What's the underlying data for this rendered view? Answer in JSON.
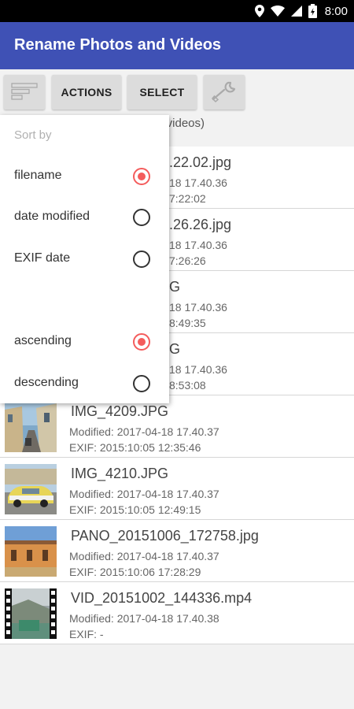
{
  "status_bar": {
    "time": "8:00",
    "icons": [
      "location-icon",
      "wifi-icon",
      "signal-icon",
      "battery-icon"
    ]
  },
  "app_bar": {
    "title": "Rename Photos and Videos",
    "color": "#3f51b5"
  },
  "toolbar": {
    "sort_icon": "sort-icon",
    "actions_label": "ACTIONS",
    "select_label": "SELECT",
    "tools_icon": "wrench-icon",
    "info_text": "s/videos)"
  },
  "sort_menu": {
    "header": "Sort by",
    "accent": "#f45c5c",
    "options": [
      {
        "label": "filename",
        "checked": true
      },
      {
        "label": "date modified",
        "checked": false
      },
      {
        "label": "EXIF date",
        "checked": false
      }
    ],
    "order": [
      {
        "label": "ascending",
        "checked": true
      },
      {
        "label": "descending",
        "checked": false
      }
    ]
  },
  "files": [
    {
      "name": ".22.02.jpg",
      "modified": "18 17.40.36",
      "exif": "7:22:02",
      "thumb": "none"
    },
    {
      "name": ".26.26.jpg",
      "modified": "18 17.40.36",
      "exif": "7:26:26",
      "thumb": "none"
    },
    {
      "name": "G",
      "modified": "18 17.40.36",
      "exif": "8:49:35",
      "thumb": "none"
    },
    {
      "name": "G",
      "modified": "18 17.40.36",
      "exif": "8:53:08",
      "thumb": "none"
    },
    {
      "name": "IMG_4209.JPG",
      "modified": "Modified: 2017-04-18 17.40.37",
      "exif": "EXIF: 2015:10:05 12:35:46",
      "thumb": "street"
    },
    {
      "name": "IMG_4210.JPG",
      "modified": "Modified: 2017-04-18 17.40.37",
      "exif": "EXIF: 2015:10:05 12:49:15",
      "thumb": "car"
    },
    {
      "name": "PANO_20151006_172758.jpg",
      "modified": "Modified: 2017-04-18 17.40.37",
      "exif": "EXIF: 2015:10:06 17:28:29",
      "thumb": "building"
    },
    {
      "name": "VID_20151002_144336.mp4",
      "modified": "Modified: 2017-04-18 17.40.38",
      "exif": "EXIF: -",
      "thumb": "video"
    }
  ]
}
